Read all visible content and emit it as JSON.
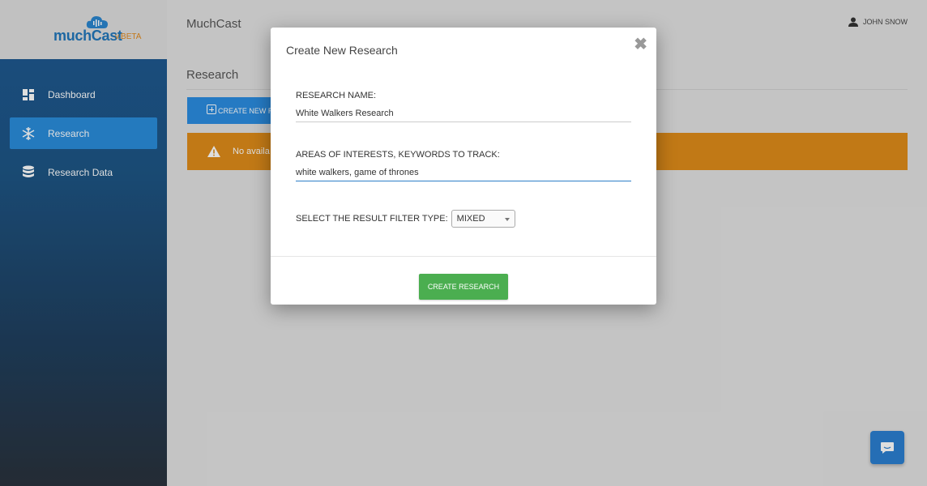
{
  "brand": {
    "name": "muchCast",
    "version": "v.BETA",
    "logo_icon": "cloud-broadcast-icon"
  },
  "sidebar": {
    "items": [
      {
        "label": "Dashboard",
        "icon": "dashboard-icon",
        "active": false
      },
      {
        "label": "Research",
        "icon": "snowflake-icon",
        "active": true
      },
      {
        "label": "Research Data",
        "icon": "database-icon",
        "active": false
      }
    ]
  },
  "header": {
    "app_title": "MuchCast",
    "user_name": "JOHN SNOW",
    "user_icon": "person-icon"
  },
  "main": {
    "section_title": "Research",
    "create_button_label": "CREATE NEW R",
    "warning_text": "No availa",
    "warning_icon": "warning-triangle-icon"
  },
  "modal": {
    "title": "Create New Research",
    "close_icon": "close-icon",
    "research_name_label": "RESEARCH NAME:",
    "research_name_value": "White Walkers Research",
    "keywords_label": "AREAS OF INTERESTS, KEYWORDS TO TRACK:",
    "keywords_value": "white walkers, game of thrones",
    "filter_label": "SELECT THE RESULT FILTER TYPE:",
    "filter_selected": "MIXED",
    "submit_label": "CREATE RESEARCH"
  },
  "chat": {
    "icon": "chat-bubble-icon"
  },
  "colors": {
    "sidebar_active": "#2a8ddb",
    "primary_button": "#2b8de0",
    "warning": "#de8c1a",
    "submit": "#4bae50",
    "brand_blue": "#2277bb",
    "brand_orange": "#e08a1e"
  }
}
